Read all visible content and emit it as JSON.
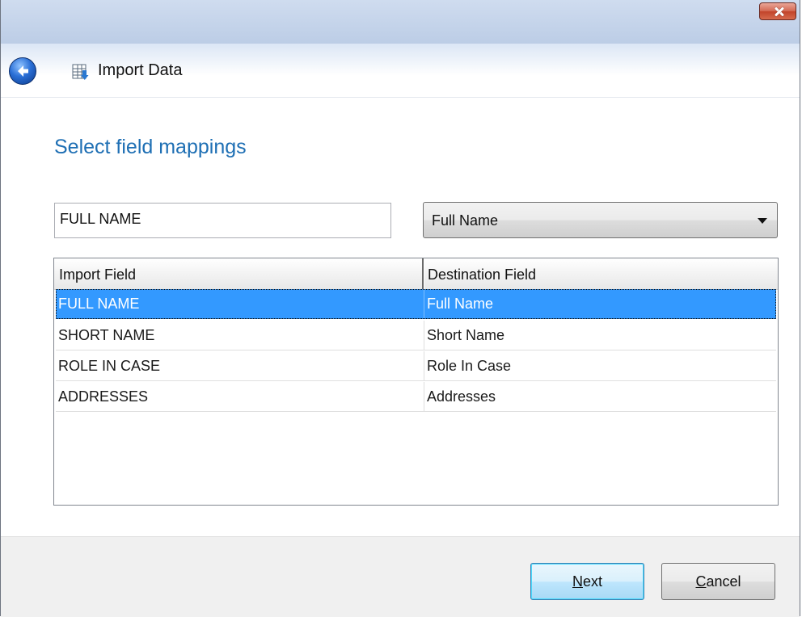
{
  "window": {
    "close_tooltip": ""
  },
  "nav": {
    "title": "Import Data"
  },
  "main": {
    "heading": "Select field mappings",
    "import_field_value": "FULL NAME",
    "destination_select": {
      "selected": "Full Name"
    }
  },
  "table": {
    "columns": [
      "Import Field",
      "Destination Field"
    ],
    "rows": [
      {
        "import": "FULL NAME",
        "destination": "Full Name",
        "selected": true
      },
      {
        "import": "SHORT NAME",
        "destination": "Short Name",
        "selected": false
      },
      {
        "import": "ROLE IN CASE",
        "destination": "Role In Case",
        "selected": false
      },
      {
        "import": "ADDRESSES",
        "destination": "Addresses",
        "selected": false
      }
    ]
  },
  "buttons": {
    "next_mnemonic": "N",
    "next_rest": "ext",
    "cancel_mnemonic": "C",
    "cancel_rest": "ancel"
  },
  "colors": {
    "heading": "#1e6fb4",
    "selection": "#3399ff"
  }
}
